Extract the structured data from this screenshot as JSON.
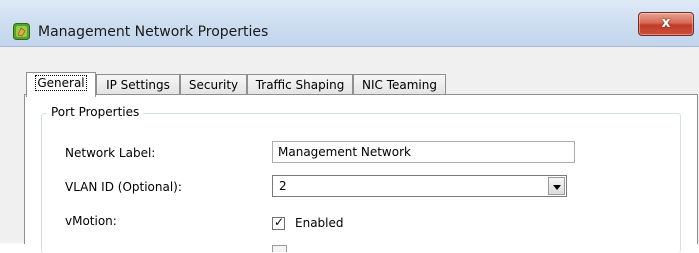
{
  "window": {
    "title": "Management Network Properties",
    "close_symbol": "x",
    "app_icon": "vsphere-app-icon"
  },
  "tabs": [
    {
      "label": "General",
      "active": true
    },
    {
      "label": "IP Settings",
      "active": false
    },
    {
      "label": "Security",
      "active": false
    },
    {
      "label": "Traffic Shaping",
      "active": false
    },
    {
      "label": "NIC Teaming",
      "active": false
    }
  ],
  "port_properties": {
    "legend": "Port Properties",
    "network_label": {
      "label": "Network Label:",
      "value": "Management Network"
    },
    "vlan_id": {
      "label": "VLAN ID (Optional):",
      "value": "2"
    },
    "vmotion": {
      "label": "vMotion:",
      "checkbox_label": "Enabled",
      "checked": true
    }
  },
  "colors": {
    "titlebar": "#cfdff1",
    "close_button": "#c23c28",
    "panel": "#ffffff"
  }
}
